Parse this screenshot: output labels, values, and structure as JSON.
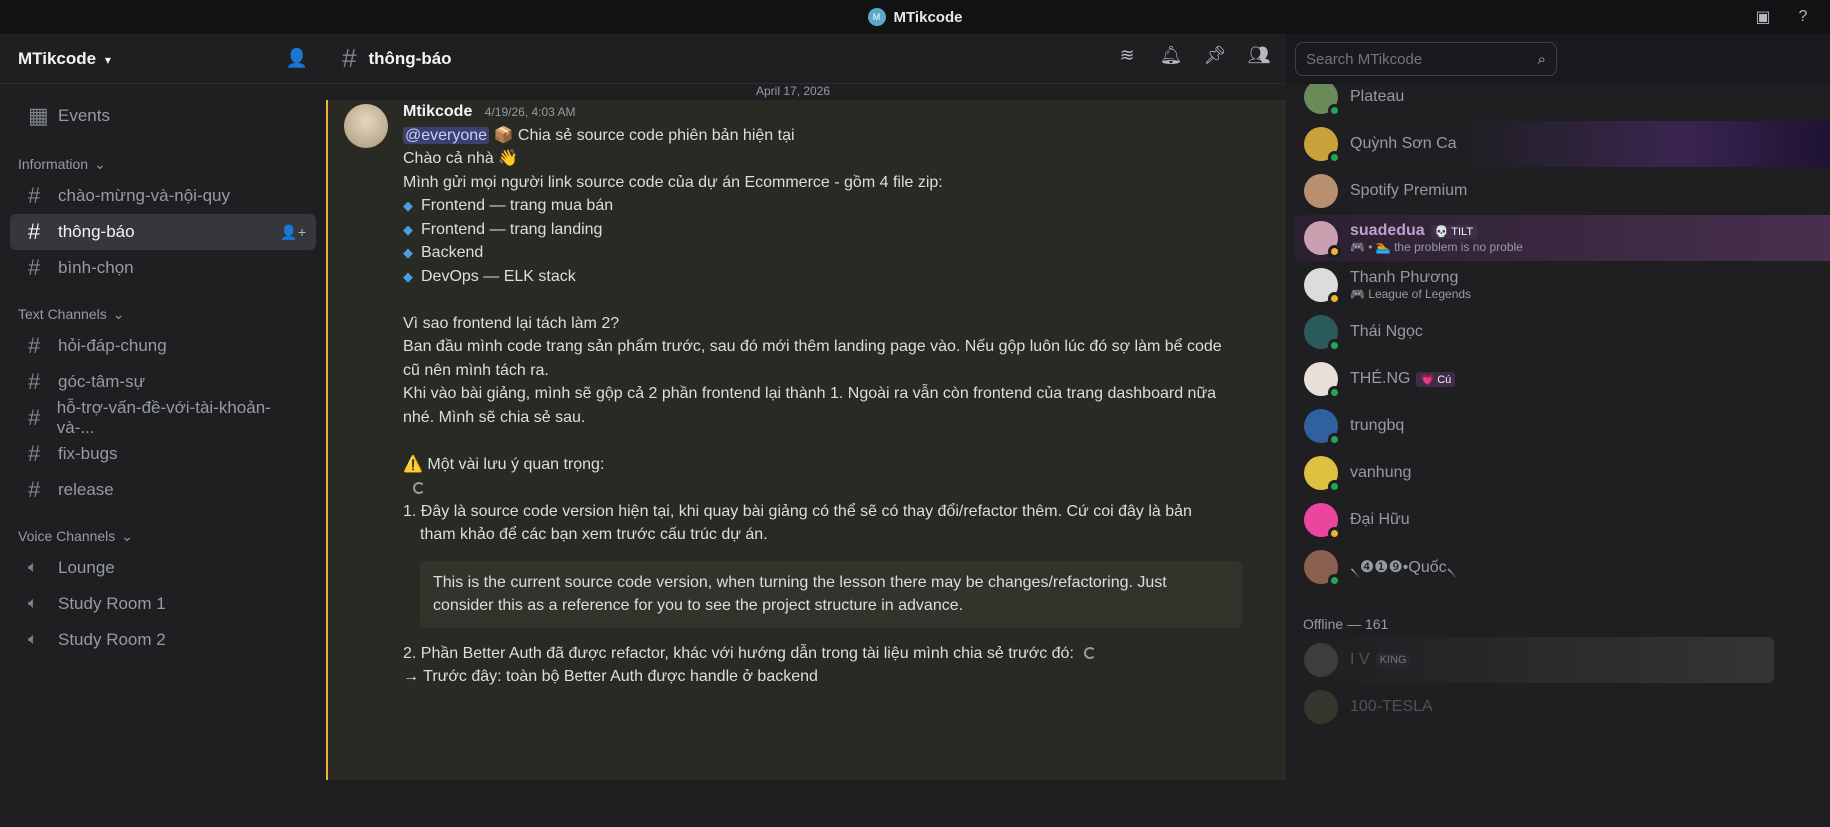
{
  "window": {
    "title": "MTikcode"
  },
  "sidebar": {
    "guild_name": "MTikcode",
    "events_label": "Events",
    "info_category": "Information",
    "info_channels": [
      "chào-mừng-và-nội-quy",
      "thông-báo",
      "bình-chọn"
    ],
    "text_category": "Text Channels",
    "text_channels": [
      "hỏi-đáp-chung",
      "góc-tâm-sự",
      "hỗ-trợ-vấn-đề-với-tài-khoản-và-...",
      "fix-bugs",
      "release"
    ],
    "voice_category": "Voice Channels",
    "voice_channels": [
      "Lounge",
      "Study Room 1",
      "Study Room 2"
    ]
  },
  "channel": {
    "name": "thông-báo"
  },
  "search": {
    "placeholder": "Search MTikcode"
  },
  "message": {
    "date_divider": "April 17, 2026",
    "author": "Mtikcode",
    "timestamp": "4/19/26, 4:03 AM",
    "mention": "@everyone",
    "line1": "📦 Chia sẻ source code phiên bản hiện tại",
    "line2": "Chào cả nhà 👋",
    "line3": "Mình gửi mọi người link source code của dự án Ecommerce - gồm 4 file zip:",
    "bullets": [
      "Frontend — trang mua bán",
      "Frontend — trang landing",
      "Backend",
      "DevOps — ELK stack"
    ],
    "why_title": "Vì sao frontend lại tách làm 2?",
    "why_1": "Ban đầu mình code trang sản phẩm trước, sau đó mới thêm landing page vào. Nếu gộp luôn lúc đó sợ làm bể code",
    "why_2": "cũ nên mình tách ra.",
    "why_3": "Khi vào bài giảng, mình sẽ gộp cả 2 phần frontend lại thành 1. Ngoài ra vẫn còn frontend của trang dashboard nữa",
    "why_4": "nhé. Mình sẽ chia sẻ sau.",
    "notes_title": "⚠️ Một vài lưu ý quan trọng:",
    "note1_a": "1. Đây là source code version hiện tại, khi quay bài giảng có thể sẽ có thay đổi/refactor thêm. Cứ coi đây là bản",
    "note1_b": "tham khảo để các bạn xem trước cấu trúc dự án.",
    "quote_a": "This is the current source code version, when turning the lesson there may be changes/refactoring. Just",
    "quote_b": "consider this as a reference for you to see the project structure in advance.",
    "note2": "2. Phần Better Auth đã được refactor, khác với hướng dẫn trong tài liệu mình chia sẻ trước đó:",
    "note2_sub": "→ Trước đây: toàn bộ Better Auth được handle ở backend"
  },
  "members": [
    {
      "name": "Plateau",
      "status": "online",
      "color": "#6a8a5a"
    },
    {
      "name": "Quỳnh Sơn Ca",
      "status": "online",
      "color": "#c9a23a"
    },
    {
      "name": "Spotify Premium",
      "status": "none",
      "color": "#b89070"
    },
    {
      "name": "suadedua",
      "tag": "💀 TILT",
      "sub": "🎮 • 🏊 the problem is no proble",
      "status": "idle",
      "color": "#c8a0b0"
    },
    {
      "name": "Thanh Phương",
      "sub": "🎮 League of Legends",
      "status": "idle",
      "color": "#dcdcdc"
    },
    {
      "name": "Thái Ngọc",
      "status": "online",
      "color": "#2a5a5a"
    },
    {
      "name": "THÉ.NG",
      "tag": "💗 Cú",
      "status": "online",
      "color": "#e8e0d8"
    },
    {
      "name": "trungbq",
      "status": "online",
      "color": "#3060a0"
    },
    {
      "name": "vanhung",
      "status": "online",
      "color": "#e0c040"
    },
    {
      "name": "Đại Hữu",
      "status": "idle",
      "color": "#eb459e"
    },
    {
      "name": "৲❹❶❾•Quốc৲",
      "status": "online",
      "color": "#8a6050"
    }
  ],
  "offline_header": "Offline — 161",
  "offline_members": [
    {
      "name": "I V",
      "tag": "KING",
      "color": "#6a6a6a"
    },
    {
      "name": "100-TESLA",
      "color": "#5a5a40"
    }
  ]
}
